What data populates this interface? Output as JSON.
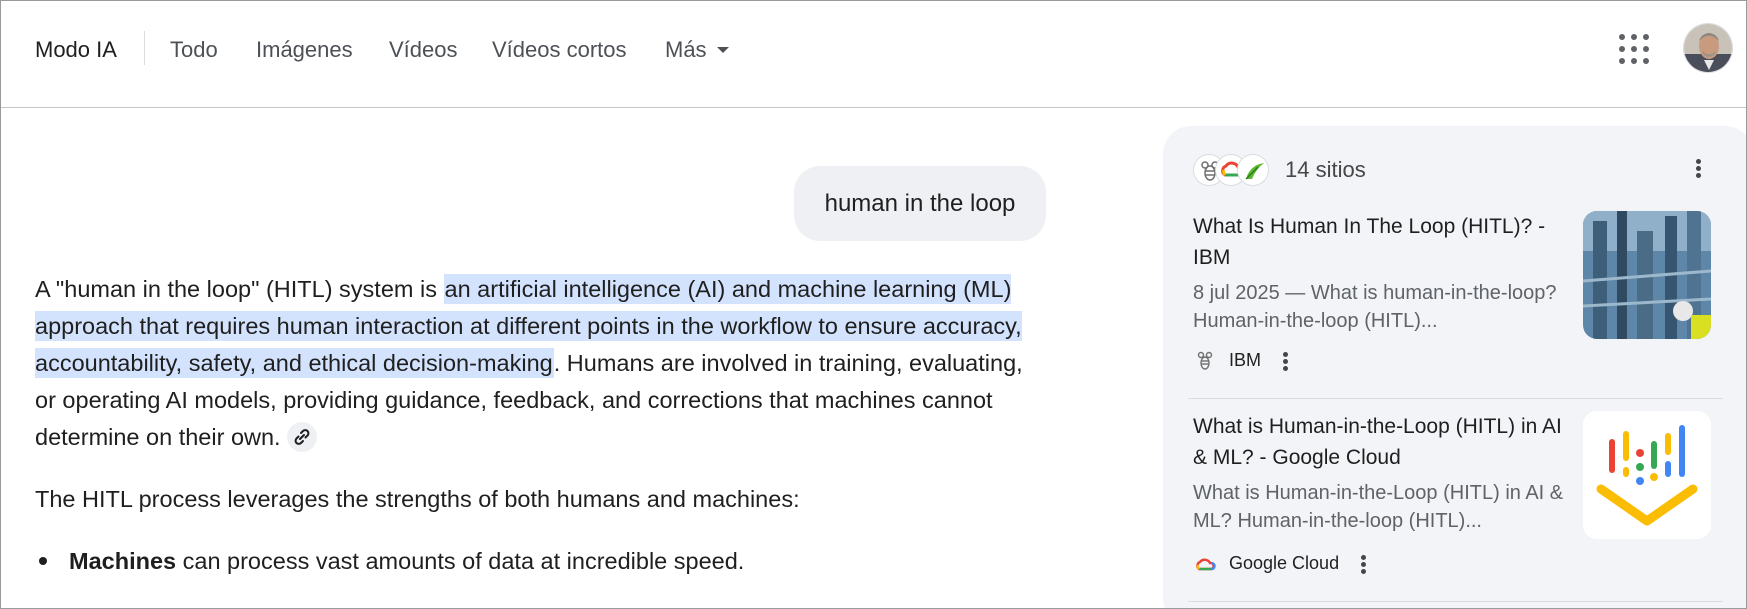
{
  "nav": {
    "tabs": [
      {
        "label": "Modo IA",
        "active": true
      },
      {
        "label": "Todo"
      },
      {
        "label": "Imágenes"
      },
      {
        "label": "Vídeos"
      },
      {
        "label": "Vídeos cortos"
      },
      {
        "label": "Más"
      }
    ],
    "apps_icon": "apps-grid-icon",
    "avatar": "user-avatar"
  },
  "conversation": {
    "query": "human in the loop",
    "answer": {
      "lead": "A \"human in the loop\" (HITL) system is ",
      "highlight": "an artificial intelligence (AI) and machine learning (ML) approach that requires human interaction at different points in the workflow to ensure accuracy, accountability, safety, and ethical decision-making",
      "tail": ". Humans are involved in training, evaluating, or operating AI models, providing guidance, feedback, and corrections that machines cannot determine on their own.",
      "link_icon": "link-icon"
    },
    "paragraph2": "The HITL process leverages the strengths of both humans and machines:",
    "bullets": [
      {
        "bold": "Machines",
        "text": " can process vast amounts of data at incredible speed."
      }
    ]
  },
  "sources": {
    "count_label": "14 sitios",
    "items": [
      {
        "title": "What Is Human In The Loop (HITL)? - IBM",
        "snippet": "8 jul 2025 — What is human-in-the-loop? Human-in-the-loop (HITL)...",
        "source": "IBM",
        "icon": "ibm-bee-icon"
      },
      {
        "title": "What is Human-in-the-Loop (HITL) in AI & ML? - Google Cloud",
        "snippet": "What is Human-in-the-Loop (HITL) in AI & ML? Human-in-the-loop (HITL)...",
        "source": "Google Cloud",
        "icon": "google-cloud-icon"
      }
    ]
  },
  "colors": {
    "highlight": "#d3e3fd",
    "panel_bg": "#f2f4f7",
    "query_bg": "#eef0f3"
  }
}
